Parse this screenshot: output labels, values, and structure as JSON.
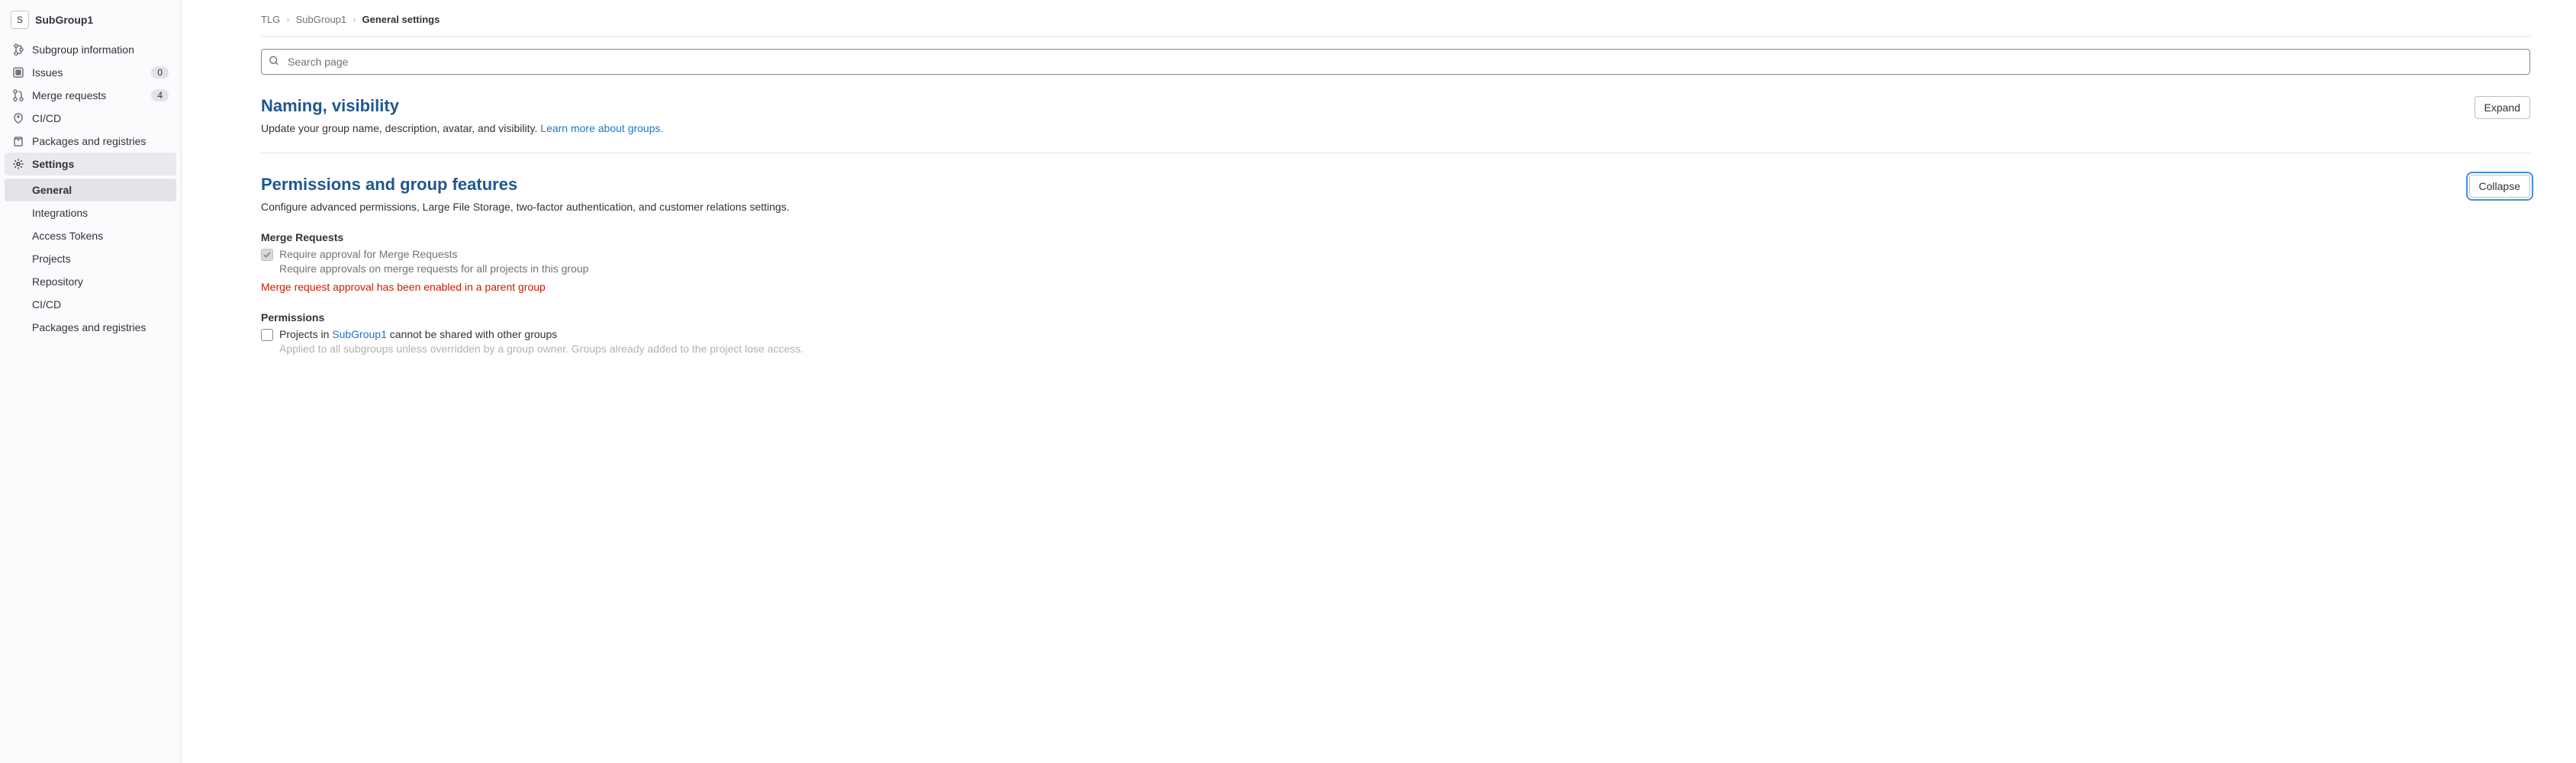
{
  "sidebar": {
    "avatar_letter": "S",
    "title": "SubGroup1",
    "items": [
      {
        "label": "Subgroup information",
        "badge": null
      },
      {
        "label": "Issues",
        "badge": "0"
      },
      {
        "label": "Merge requests",
        "badge": "4"
      },
      {
        "label": "CI/CD",
        "badge": null
      },
      {
        "label": "Packages and registries",
        "badge": null
      },
      {
        "label": "Settings",
        "badge": null
      }
    ],
    "sub_items": [
      {
        "label": "General"
      },
      {
        "label": "Integrations"
      },
      {
        "label": "Access Tokens"
      },
      {
        "label": "Projects"
      },
      {
        "label": "Repository"
      },
      {
        "label": "CI/CD"
      },
      {
        "label": "Packages and registries"
      }
    ]
  },
  "breadcrumbs": {
    "parts": [
      "TLG",
      "SubGroup1",
      "General settings"
    ]
  },
  "search": {
    "placeholder": "Search page"
  },
  "sections": {
    "naming": {
      "title": "Naming, visibility",
      "button": "Expand",
      "description": "Update your group name, description, avatar, and visibility. ",
      "link": "Learn more about groups."
    },
    "permissions": {
      "title": "Permissions and group features",
      "button": "Collapse",
      "description": "Configure advanced permissions, Large File Storage, two-factor authentication, and customer relations settings.",
      "merge_requests": {
        "title": "Merge Requests",
        "check_label": "Require approval for Merge Requests",
        "help": "Require approvals on merge requests for all projects in this group",
        "warning": "Merge request approval has been enabled in a parent group"
      },
      "perms": {
        "title": "Permissions",
        "label_prefix": "Projects in ",
        "label_link": "SubGroup1",
        "label_suffix": " cannot be shared with other groups",
        "help": "Applied to all subgroups unless overridden by a group owner. Groups already added to the project lose access."
      }
    }
  }
}
